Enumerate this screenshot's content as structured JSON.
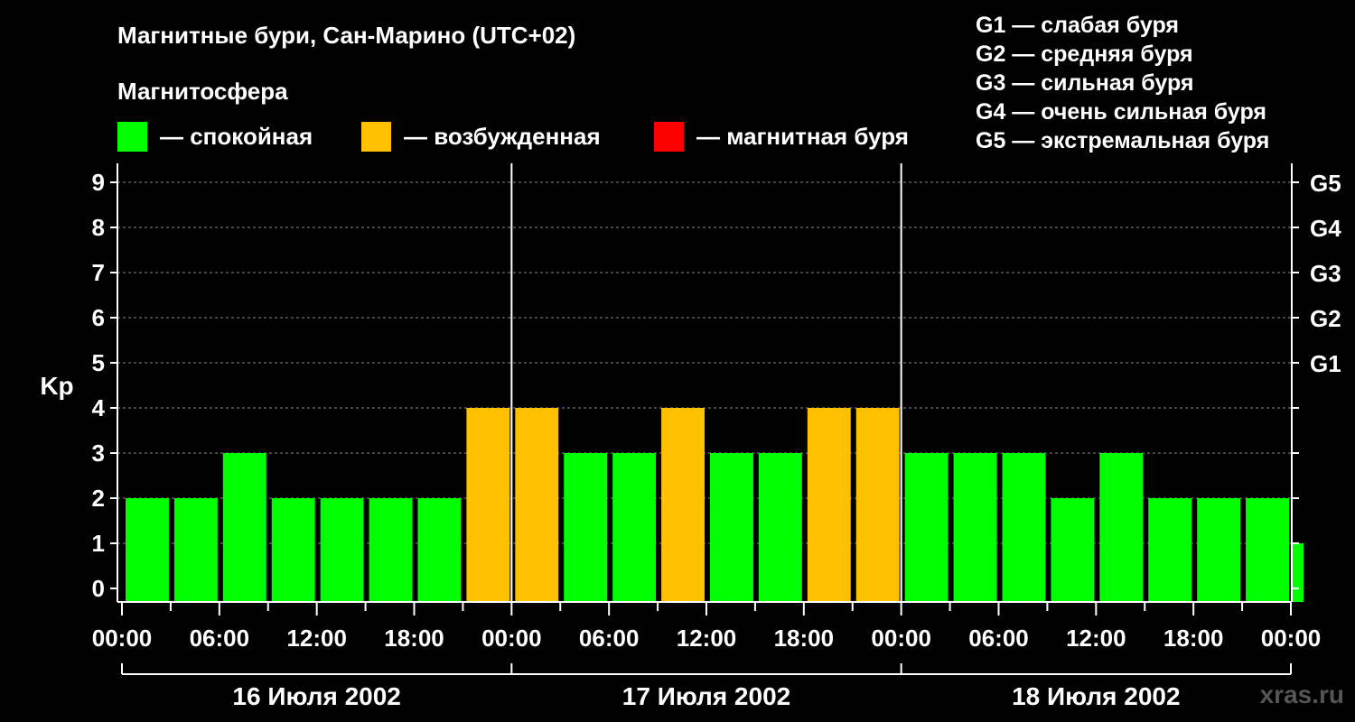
{
  "header": {
    "title": "Магнитные бури, Сан-Марино (UTC+02)",
    "subtitle": "Магнитосфера"
  },
  "legend": [
    {
      "label": "— спокойная",
      "color": "#00ff00"
    },
    {
      "label": "— возбужденная",
      "color": "#ffc000"
    },
    {
      "label": "— магнитная буря",
      "color": "#ff0000"
    }
  ],
  "g_scale": [
    "G1 — слабая буря",
    "G2 — средняя буря",
    "G3 — сильная буря",
    "G4 — очень сильная буря",
    "G5 — экстремальная буря"
  ],
  "watermark": "xras.ru",
  "chart_data": {
    "type": "bar",
    "ylabel": "Kp",
    "ylim": [
      0,
      9
    ],
    "y_ticks": [
      "0",
      "1",
      "2",
      "3",
      "4",
      "5",
      "6",
      "7",
      "8",
      "9"
    ],
    "right_axis_labels": [
      {
        "kp": 5,
        "label": "G1"
      },
      {
        "kp": 6,
        "label": "G2"
      },
      {
        "kp": 7,
        "label": "G3"
      },
      {
        "kp": 8,
        "label": "G4"
      },
      {
        "kp": 9,
        "label": "G5"
      }
    ],
    "x_tick_labels": [
      "00:00",
      "06:00",
      "12:00",
      "18:00",
      "00:00",
      "06:00",
      "12:00",
      "18:00",
      "00:00",
      "06:00",
      "12:00",
      "18:00",
      "00:00"
    ],
    "days": [
      "16 Июля 2002",
      "17 Июля 2002",
      "18 Июля 2002"
    ],
    "categories": [
      "00:00",
      "03:00",
      "06:00",
      "09:00",
      "12:00",
      "15:00",
      "18:00",
      "21:00",
      "00:00",
      "03:00",
      "06:00",
      "09:00",
      "12:00",
      "15:00",
      "18:00",
      "21:00",
      "00:00",
      "03:00",
      "06:00",
      "09:00",
      "12:00",
      "15:00",
      "18:00",
      "21:00"
    ],
    "values": [
      2,
      2,
      3,
      2,
      2,
      2,
      2,
      4,
      4,
      3,
      3,
      4,
      3,
      3,
      4,
      4,
      3,
      3,
      3,
      2,
      3,
      2,
      2,
      2,
      1
    ],
    "colors": {
      "quiet": "#00ff00",
      "active": "#ffc000",
      "storm": "#ff0000"
    },
    "grid": true
  }
}
